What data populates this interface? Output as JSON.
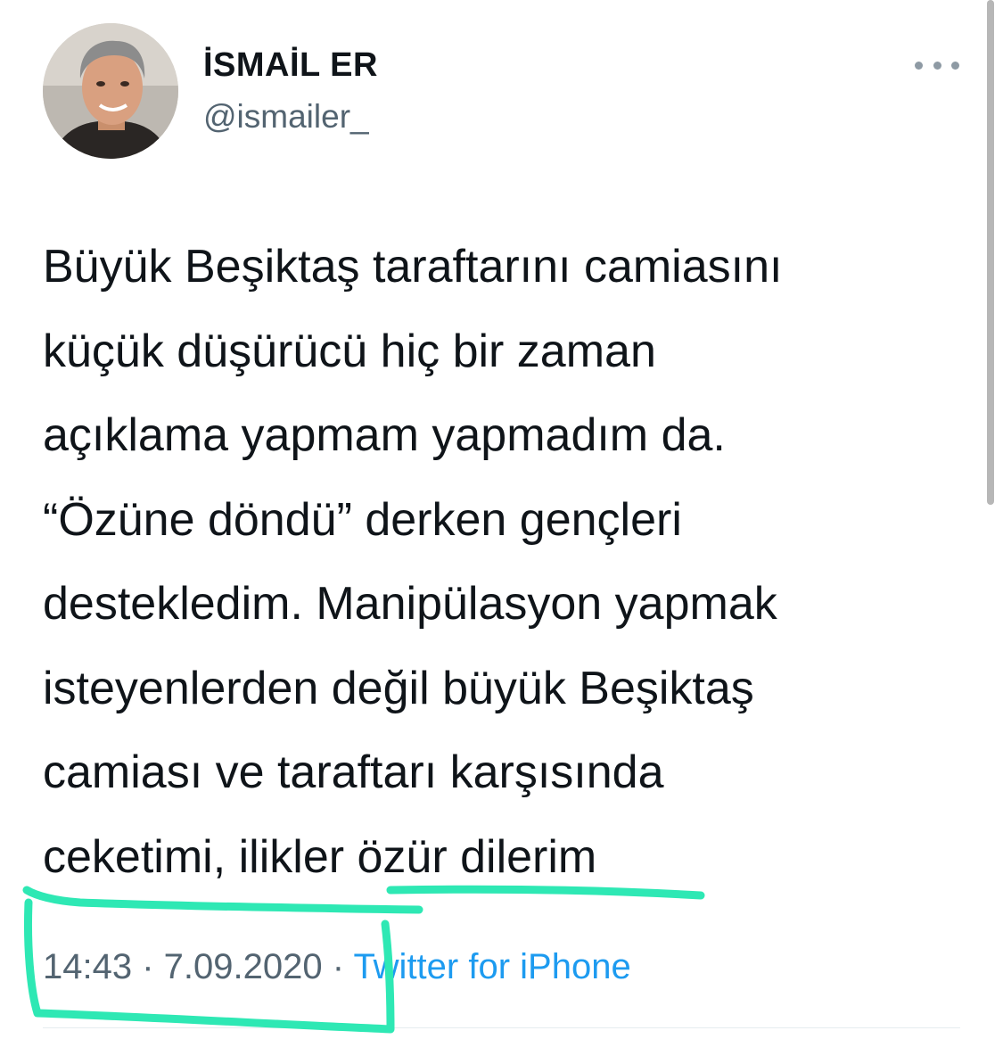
{
  "author": {
    "display_name": "İSMAİL ER",
    "handle": "@ismailer_",
    "avatar_icon": "profile-photo"
  },
  "more_icon": "more-horizontal-icon",
  "tweet": {
    "lines": [
      "Büyük Beşiktaş taraftarını camiasını",
      "küçük düşürücü hiç bir zaman",
      "açıklama yapmam yapmadım da.",
      "“Özüne döndü” derken gençleri",
      "destekledim. Manipülasyon yapmak",
      "isteyenlerden değil büyük Beşiktaş",
      "camiası ve taraftarı karşısında",
      "ceketimi, ilikler özür dilerim"
    ]
  },
  "meta": {
    "time": "14:43",
    "separator": " · ",
    "date": "7.09.2020",
    "source": "Twitter for iPhone"
  },
  "colors": {
    "text": "#0f1419",
    "secondary": "#536471",
    "link": "#1d9bf0",
    "annotation_marker": "#2ee8b4"
  }
}
